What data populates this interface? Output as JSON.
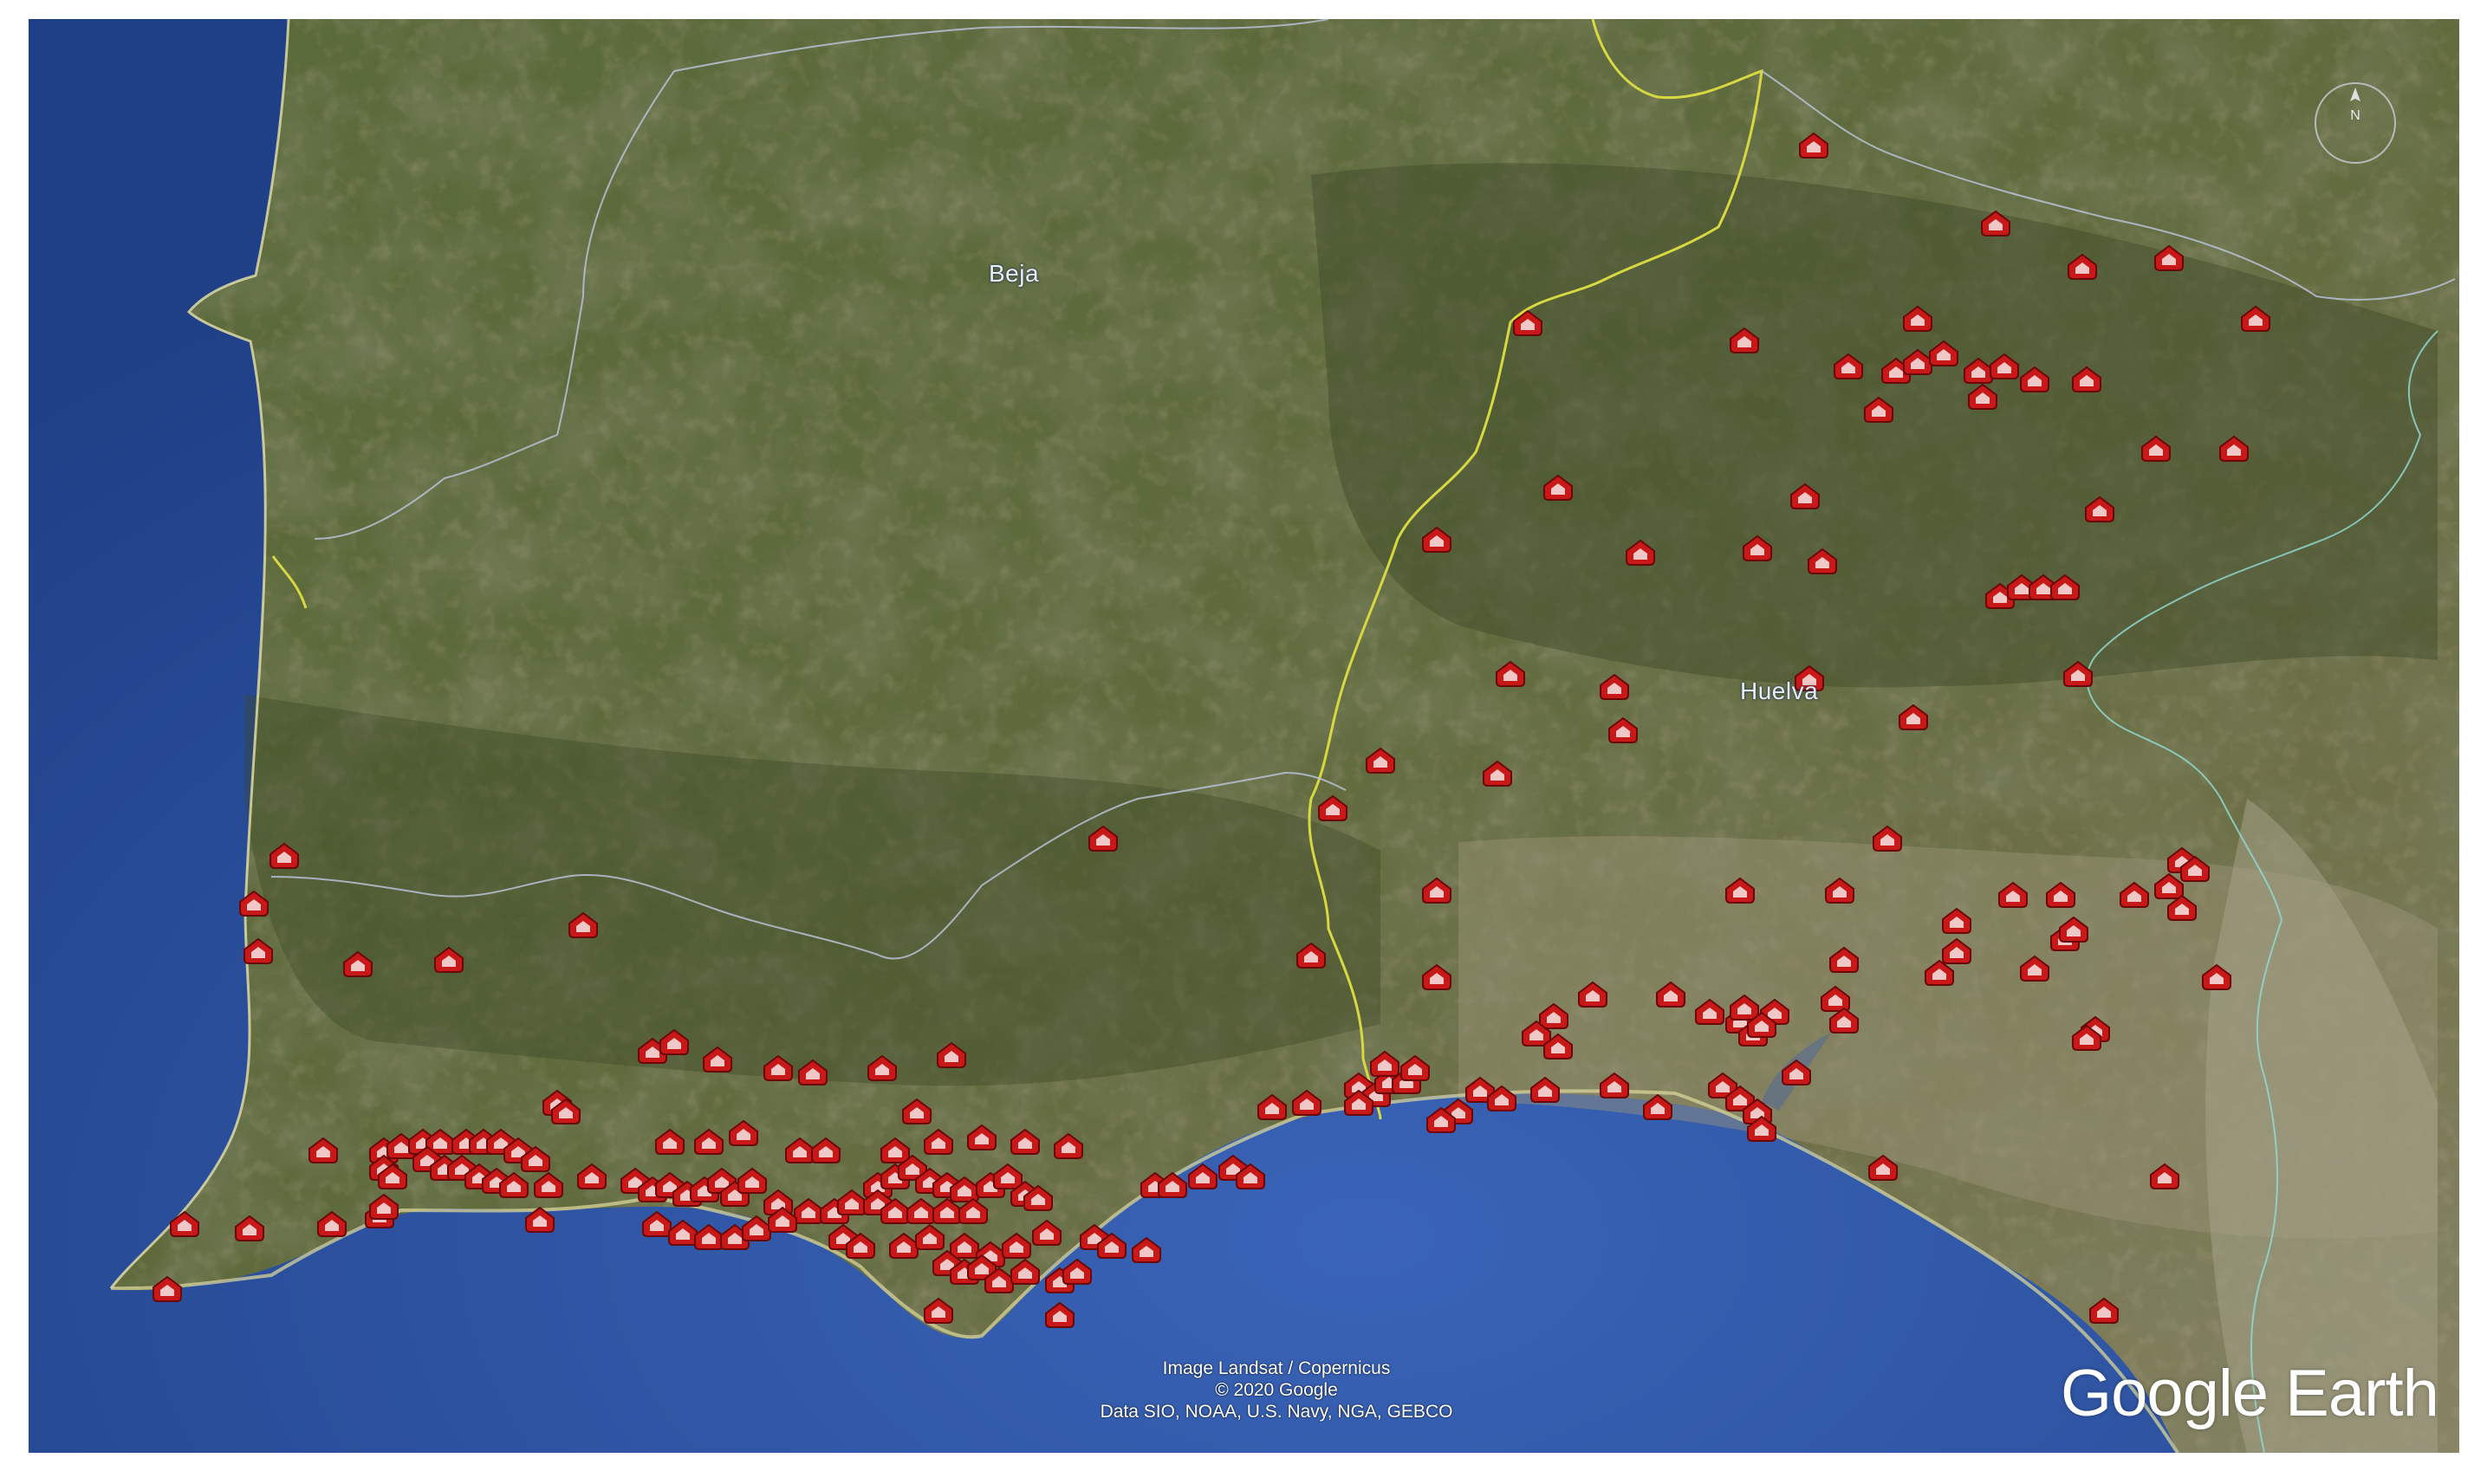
{
  "map": {
    "labels": {
      "beja": "Beja",
      "huelva": "Huelva"
    },
    "attribution": {
      "line1": "Image Landsat / Copernicus",
      "line2": "© 2020 Google",
      "line3": "Data SIO, NOAA, U.S. Navy, NGA, GEBCO"
    },
    "brand": "Google Earth",
    "compass": {
      "north": "N"
    },
    "colors": {
      "ocean": "#2a4e9c",
      "land": "#5a6838",
      "border_national": "#d8d840",
      "border_regional": "#b8c2d8",
      "river_border": "#8fd8d0",
      "marker_fill": "#c81818",
      "marker_inner": "#f0c8c8"
    },
    "marker_icon": "house-pin-icon"
  }
}
